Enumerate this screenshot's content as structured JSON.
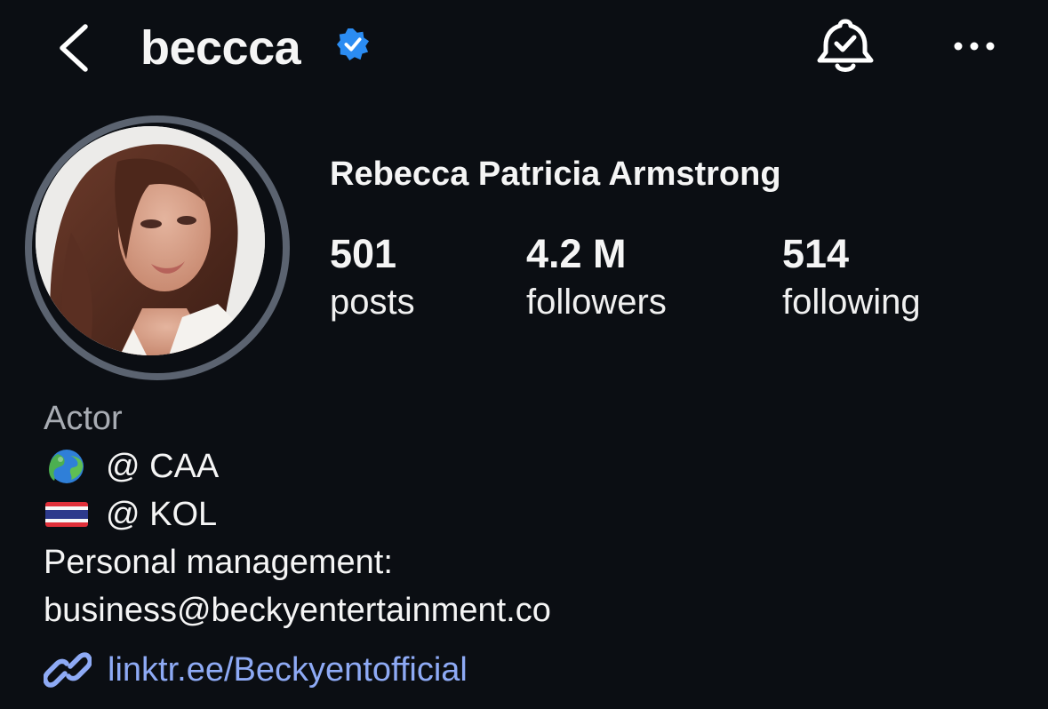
{
  "header": {
    "username": "beccca",
    "back_icon": "chevron-left-icon",
    "verified_icon": "verified-badge-icon",
    "notifications_icon": "bell-check-icon",
    "more_icon": "more-horizontal-icon"
  },
  "profile": {
    "full_name": "Rebecca Patricia Armstrong",
    "stats": [
      {
        "count": "501",
        "label": "posts"
      },
      {
        "count": "4.2 M",
        "label": "followers"
      },
      {
        "count": "514",
        "label": "following"
      }
    ]
  },
  "bio": {
    "category": "Actor",
    "lines": [
      {
        "icon": "globe-emoji",
        "text": "@ CAA"
      },
      {
        "icon": "thailand-flag-emoji",
        "text": "@ KOL"
      },
      {
        "text": "Personal management:"
      },
      {
        "text": "business@beckyentertainment.co"
      }
    ],
    "link": {
      "icon": "link-icon",
      "text": "linktr.ee/Beckyentofficial"
    }
  },
  "colors": {
    "background": "#0b0e13",
    "text": "#f5f5f5",
    "muted": "#a8acb3",
    "link": "#8eaaf5",
    "verified": "#2b8cf2",
    "avatar_ring": "#5b6370"
  }
}
